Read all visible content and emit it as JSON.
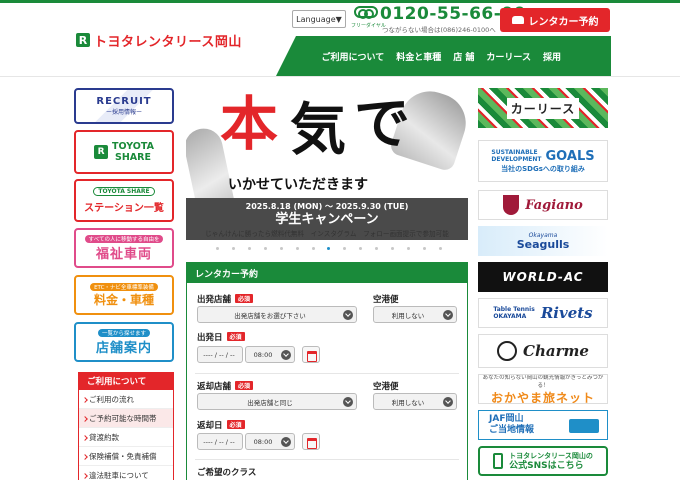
{
  "header": {
    "logo_mark": "R",
    "logo_text": "トヨタレンタリース岡山",
    "language_label": "Language▼",
    "freedial_label": "フリーダイヤル",
    "phone": "0120-55-66-00",
    "phone_note": "つながらない場合は(086)246-0100へ",
    "reserve_button": "レンタカー予約",
    "nav": [
      "ご利用について",
      "料金と車種",
      "店 舗",
      "カーリース",
      "採用"
    ]
  },
  "left_sidebar": {
    "recruit": {
      "title": "RECRUIT",
      "sub": "ー採用情報ー"
    },
    "toyota_share": {
      "line1": "TOYOTA",
      "line2": "SHARE"
    },
    "station_list": {
      "badge": "TOYOTA SHARE",
      "label": "ステーション一覧"
    },
    "welfare": {
      "note": "すべての人に移動する自由を",
      "label": "福祉車両"
    },
    "rates": {
      "note": "ETC・ナビ全車標準装備",
      "label": "料金・車種"
    },
    "stores": {
      "note": "一覧から探せます",
      "label": "店舗案内"
    },
    "menu": {
      "heading": "ご利用について",
      "items": [
        "ご利用の流れ",
        "ご予約可能な時間帯",
        "貸渡約款",
        "保険補償・免責補償",
        "違法駐車について"
      ]
    }
  },
  "slider": {
    "char_hon": "本",
    "char_ki": "気",
    "char_de": "で",
    "subtitle": "いかせていただきます",
    "dates": "2025.8.18 (MON) 〜 2025.9.30 (TUE)",
    "campaign": "学生キャンペーン",
    "caption": "じゃんけんに勝ったら燃料代無料　インスタグラム　フォロー画面提示で参加可能",
    "dot_count": 15,
    "active_dot": 7
  },
  "reservation": {
    "heading": "レンタカー予約",
    "required_label": "必須",
    "depart_store_label": "出発店舗",
    "depart_store_value": "出発店舗をお選び下さい",
    "airport_label": "空港便",
    "airport_value": "利用しない",
    "depart_date_label": "出発日",
    "date_value": "---- / -- / --",
    "time_value": "08:00",
    "return_store_label": "返却店舗",
    "return_store_value": "出発店舗と同じ",
    "return_airport_value": "利用しない",
    "return_date_label": "返却日",
    "class_label": "ご希望のクラス"
  },
  "right_sidebar": {
    "car_lease": "カーリース",
    "sdgs": {
      "tag_line1": "SUSTAINABLE",
      "tag_line2": "DEVELOPMENT",
      "goals": "GOALS",
      "sub": "当社のSDGsへの取り組み"
    },
    "fagiano": "Fagiano",
    "seagulls": {
      "name": "Seagulls",
      "prefix": "Okayama"
    },
    "world_ac": "WORLD-AC",
    "rivets": {
      "line1": "Table Tennis",
      "line2": "OKAYAMA",
      "name": "Rivets"
    },
    "charme": "Charme",
    "okayama_travel": {
      "note": "あなたの知らない岡山の観光情報がきっとみつかる！",
      "name": "おかやま旅ネット"
    },
    "jaf": {
      "line1": "JAF岡山",
      "line2": "ご当地情報"
    },
    "sns": {
      "line1": "トヨタレンタリース岡山の",
      "line2": "公式SNSはこちら"
    }
  },
  "colors": {
    "brand_green": "#1a8a3a",
    "brand_red": "#e3262a",
    "accent_blue": "#1f8fc8"
  }
}
